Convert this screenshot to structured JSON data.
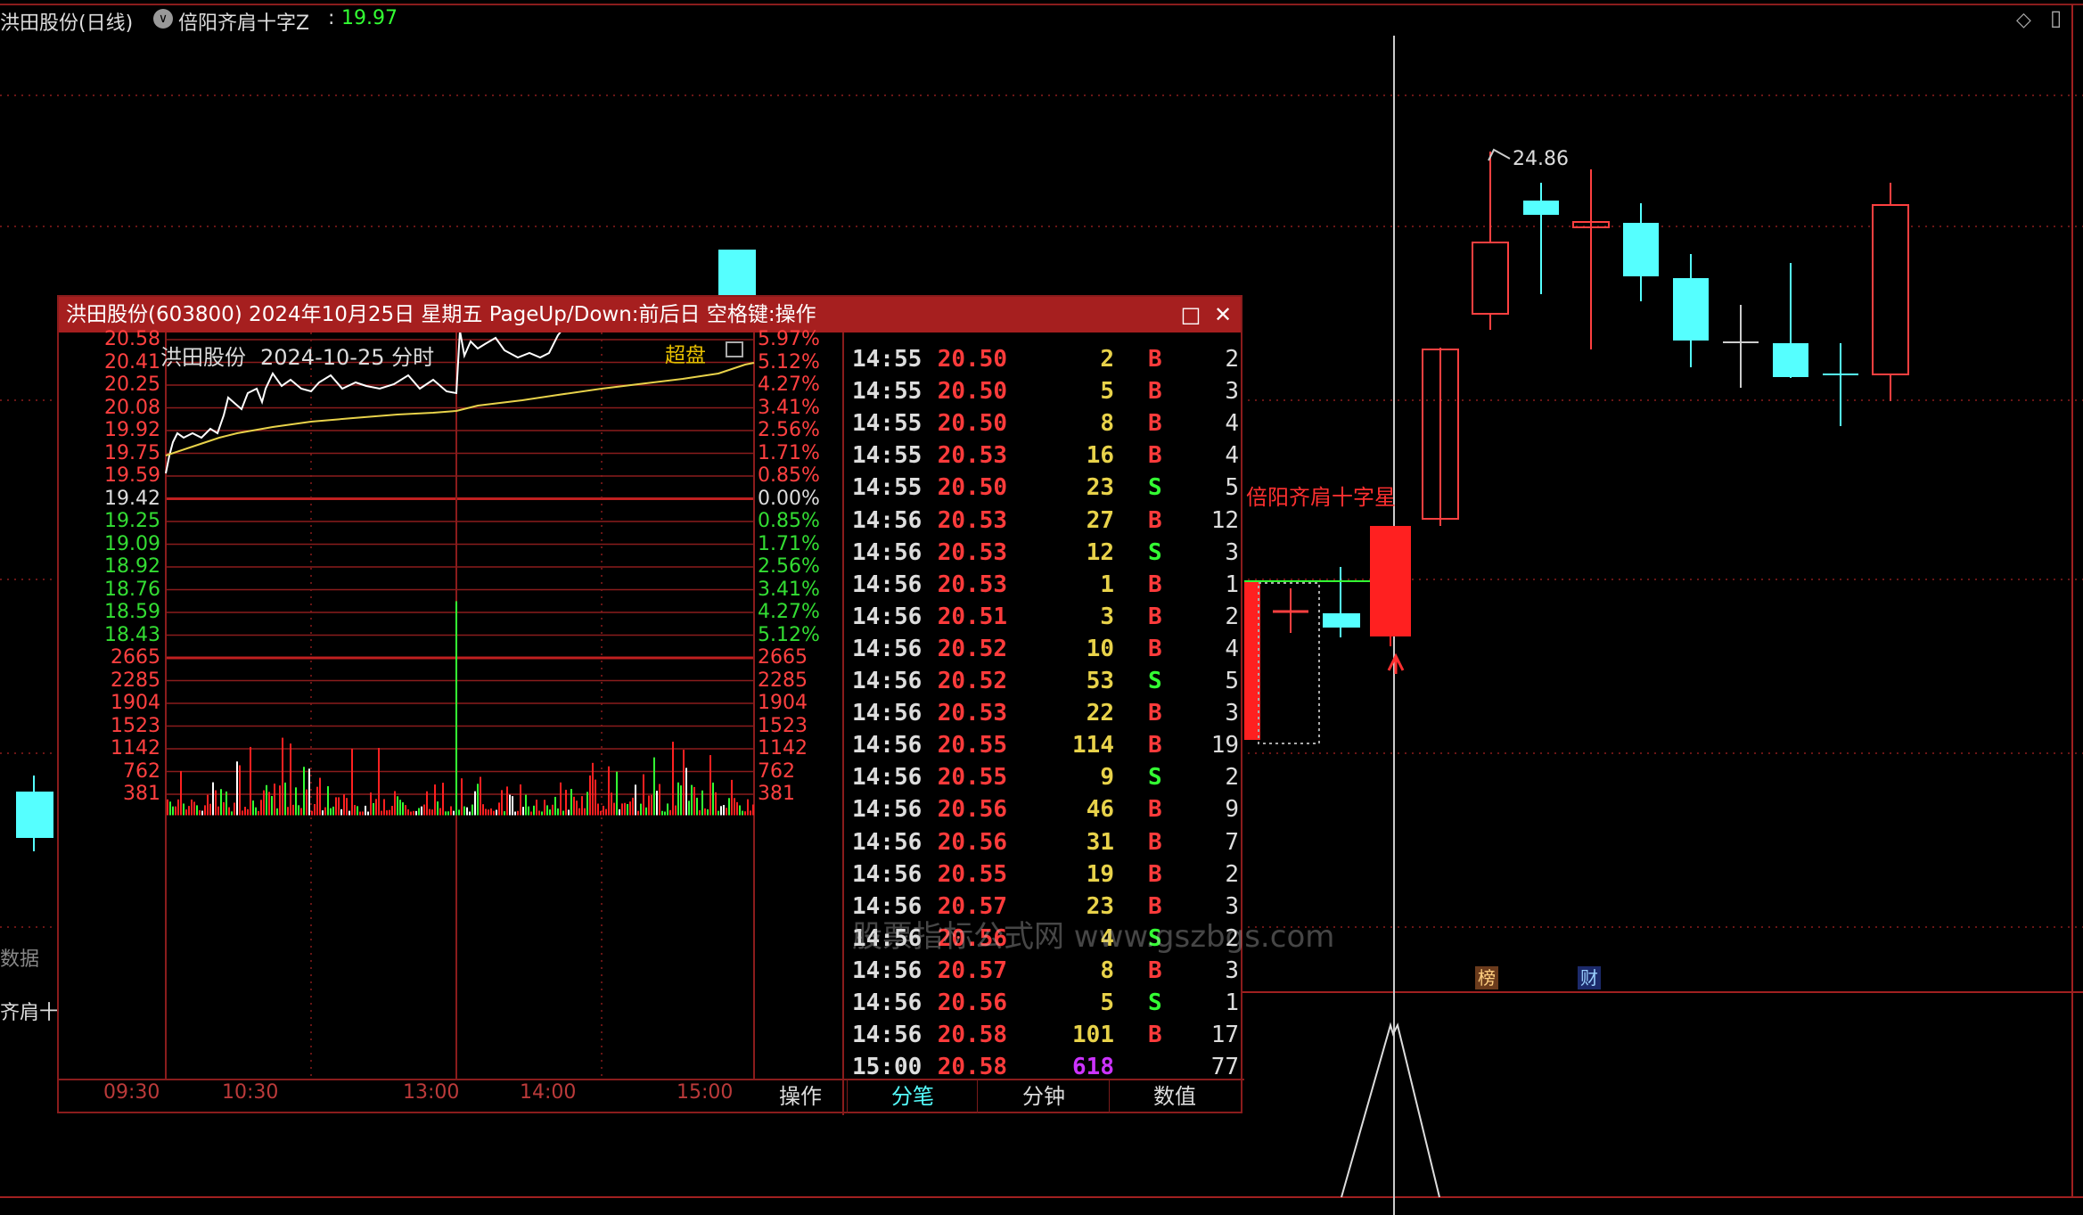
{
  "window": {
    "stock_label": "洪田股份(日线)",
    "indicator_name": "倍阳齐肩十字Z",
    "indicator_value": "19.97",
    "colors": {
      "up": "#ff2020",
      "down": "#55ffff",
      "bg": "#000000",
      "grid": "#8a1c1c"
    }
  },
  "main_chart": {
    "high_marker": "24.86",
    "signal_label": "倍阳齐肩十字星",
    "left_labels": {
      "data": "数据",
      "indicator_partial": "齐肩十字"
    },
    "bottom_badges": {
      "rank": "榜",
      "finance": "财"
    }
  },
  "popup": {
    "title": "洪田股份(603800) 2024年10月25日 星期五 PageUp/Down:前后日 空格键:操作",
    "chart_name": "洪田股份",
    "chart_date": "2024-10-25 分时",
    "chaopan_label": "超盘",
    "price_ticks": [
      "20.58",
      "20.41",
      "20.25",
      "20.08",
      "19.92",
      "19.75",
      "19.59",
      "19.42",
      "19.25",
      "19.09",
      "18.92",
      "18.76",
      "18.59",
      "18.43"
    ],
    "pct_ticks": [
      "5.97%",
      "5.12%",
      "4.27%",
      "3.41%",
      "2.56%",
      "1.71%",
      "0.85%",
      "0.00%",
      "0.85%",
      "1.71%",
      "2.56%",
      "3.41%",
      "4.27%",
      "5.12%"
    ],
    "vol_ticks": [
      "2665",
      "2285",
      "1904",
      "1523",
      "1142",
      "762",
      "381"
    ],
    "time_ticks": [
      "09:30",
      "10:30",
      "13:00",
      "14:00",
      "15:00"
    ],
    "op_label": "操作",
    "tabs": [
      "分笔",
      "分钟",
      "数值"
    ],
    "trades": [
      {
        "time": "14:55",
        "price": "20.50",
        "vol": "2",
        "bs": "B",
        "cnt": "2"
      },
      {
        "time": "14:55",
        "price": "20.50",
        "vol": "5",
        "bs": "B",
        "cnt": "3"
      },
      {
        "time": "14:55",
        "price": "20.50",
        "vol": "8",
        "bs": "B",
        "cnt": "4"
      },
      {
        "time": "14:55",
        "price": "20.53",
        "vol": "16",
        "bs": "B",
        "cnt": "4"
      },
      {
        "time": "14:55",
        "price": "20.50",
        "vol": "23",
        "bs": "S",
        "cnt": "5"
      },
      {
        "time": "14:56",
        "price": "20.53",
        "vol": "27",
        "bs": "B",
        "cnt": "12"
      },
      {
        "time": "14:56",
        "price": "20.53",
        "vol": "12",
        "bs": "S",
        "cnt": "3"
      },
      {
        "time": "14:56",
        "price": "20.53",
        "vol": "1",
        "bs": "B",
        "cnt": "1"
      },
      {
        "time": "14:56",
        "price": "20.51",
        "vol": "3",
        "bs": "B",
        "cnt": "2"
      },
      {
        "time": "14:56",
        "price": "20.52",
        "vol": "10",
        "bs": "B",
        "cnt": "4"
      },
      {
        "time": "14:56",
        "price": "20.52",
        "vol": "53",
        "bs": "S",
        "cnt": "5"
      },
      {
        "time": "14:56",
        "price": "20.53",
        "vol": "22",
        "bs": "B",
        "cnt": "3"
      },
      {
        "time": "14:56",
        "price": "20.55",
        "vol": "114",
        "bs": "B",
        "cnt": "19"
      },
      {
        "time": "14:56",
        "price": "20.55",
        "vol": "9",
        "bs": "S",
        "cnt": "2"
      },
      {
        "time": "14:56",
        "price": "20.56",
        "vol": "46",
        "bs": "B",
        "cnt": "9"
      },
      {
        "time": "14:56",
        "price": "20.56",
        "vol": "31",
        "bs": "B",
        "cnt": "7"
      },
      {
        "time": "14:56",
        "price": "20.55",
        "vol": "19",
        "bs": "B",
        "cnt": "2"
      },
      {
        "time": "14:56",
        "price": "20.57",
        "vol": "23",
        "bs": "B",
        "cnt": "3"
      },
      {
        "time": "14:56",
        "price": "20.56",
        "vol": "4",
        "bs": "S",
        "cnt": "2"
      },
      {
        "time": "14:56",
        "price": "20.57",
        "vol": "8",
        "bs": "B",
        "cnt": "3"
      },
      {
        "time": "14:56",
        "price": "20.56",
        "vol": "5",
        "bs": "S",
        "cnt": "1"
      },
      {
        "time": "14:56",
        "price": "20.58",
        "vol": "101",
        "bs": "B",
        "cnt": "17"
      },
      {
        "time": "15:00",
        "price": "20.58",
        "vol": "618",
        "bs": "",
        "cnt": "77"
      }
    ],
    "watermark": "股票指标公式网 www.gszbgs.com"
  }
}
